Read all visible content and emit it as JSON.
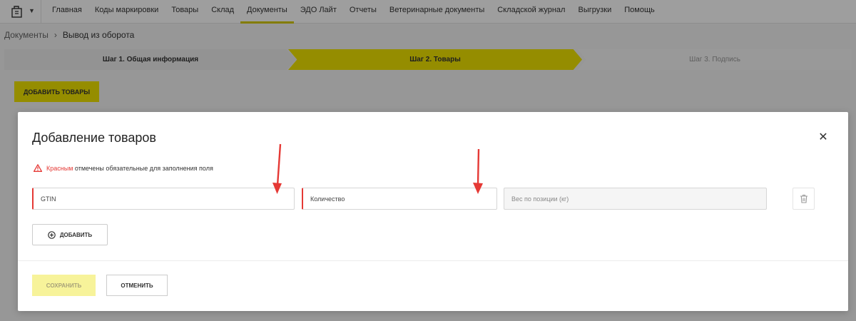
{
  "nav": {
    "items": [
      {
        "label": "Главная",
        "active": false
      },
      {
        "label": "Коды маркировки",
        "active": false
      },
      {
        "label": "Товары",
        "active": false
      },
      {
        "label": "Склад",
        "active": false
      },
      {
        "label": "Документы",
        "active": true
      },
      {
        "label": "ЭДО Лайт",
        "active": false
      },
      {
        "label": "Отчеты",
        "active": false
      },
      {
        "label": "Ветеринарные документы",
        "active": false
      },
      {
        "label": "Складской журнал",
        "active": false
      },
      {
        "label": "Выгрузки",
        "active": false
      },
      {
        "label": "Помощь",
        "active": false
      }
    ]
  },
  "breadcrumb": {
    "parent": "Документы",
    "current": "Вывод из оборота"
  },
  "steps": {
    "step1": "Шаг 1. Общая информация",
    "step2": "Шаг 2. Товары",
    "step3": "Шаг 3. Подпись"
  },
  "page": {
    "add_goods_label": "ДОБАВИТЬ ТОВАРЫ"
  },
  "modal": {
    "title": "Добавление товаров",
    "close_glyph": "✕",
    "hint_red": "Красным",
    "hint_rest": "отмечены обязательные для заполнения поля",
    "fields": {
      "gtin_placeholder": "GTIN",
      "qty_placeholder": "Количество",
      "weight_placeholder": "Вес по позиции (кг)"
    },
    "add_label": "ДОБАВИТЬ",
    "save_label": "СОХРАНИТЬ",
    "cancel_label": "ОТМЕНИТЬ"
  },
  "colors": {
    "accent": "#f0e400",
    "required": "#e53935",
    "annotation_arrow": "#e53935"
  },
  "icons": {
    "logo": "document-box-icon",
    "caret": "chevron-down-icon",
    "close": "close-icon",
    "warning": "warning-icon",
    "trash": "trash-icon",
    "add": "plus-circle-icon"
  }
}
